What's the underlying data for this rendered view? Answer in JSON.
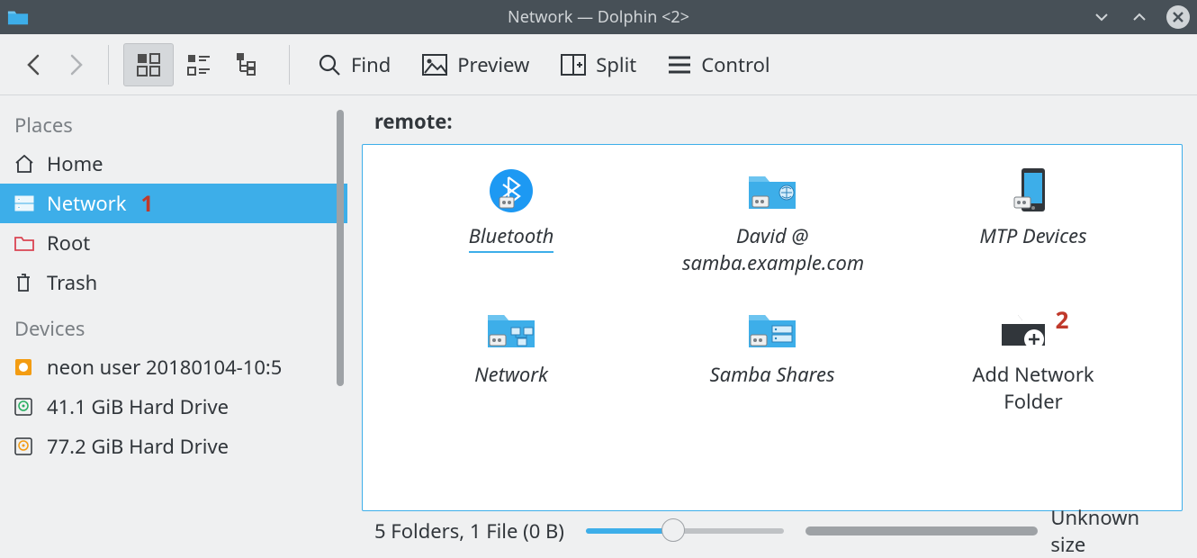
{
  "window": {
    "title": "Network — Dolphin <2>"
  },
  "toolbar": {
    "find": "Find",
    "preview": "Preview",
    "split": "Split",
    "control": "Control"
  },
  "sidebar": {
    "places_header": "Places",
    "devices_header": "Devices",
    "places": [
      {
        "label": "Home"
      },
      {
        "label": "Network"
      },
      {
        "label": "Root"
      },
      {
        "label": "Trash"
      }
    ],
    "devices": [
      {
        "label": "neon user 20180104-10:5"
      },
      {
        "label": "41.1 GiB Hard Drive"
      },
      {
        "label": "77.2 GiB Hard Drive"
      }
    ]
  },
  "annotations": {
    "a1": "1",
    "a2": "2"
  },
  "breadcrumb": "remote:",
  "tiles": [
    {
      "label": "Bluetooth"
    },
    {
      "label": "David @ samba.example.com"
    },
    {
      "label": "MTP Devices"
    },
    {
      "label": "Network"
    },
    {
      "label": "Samba Shares"
    },
    {
      "label": "Add Network Folder"
    }
  ],
  "status": {
    "summary": "5 Folders, 1 File (0 B)",
    "capacity_text": "Unknown size"
  }
}
